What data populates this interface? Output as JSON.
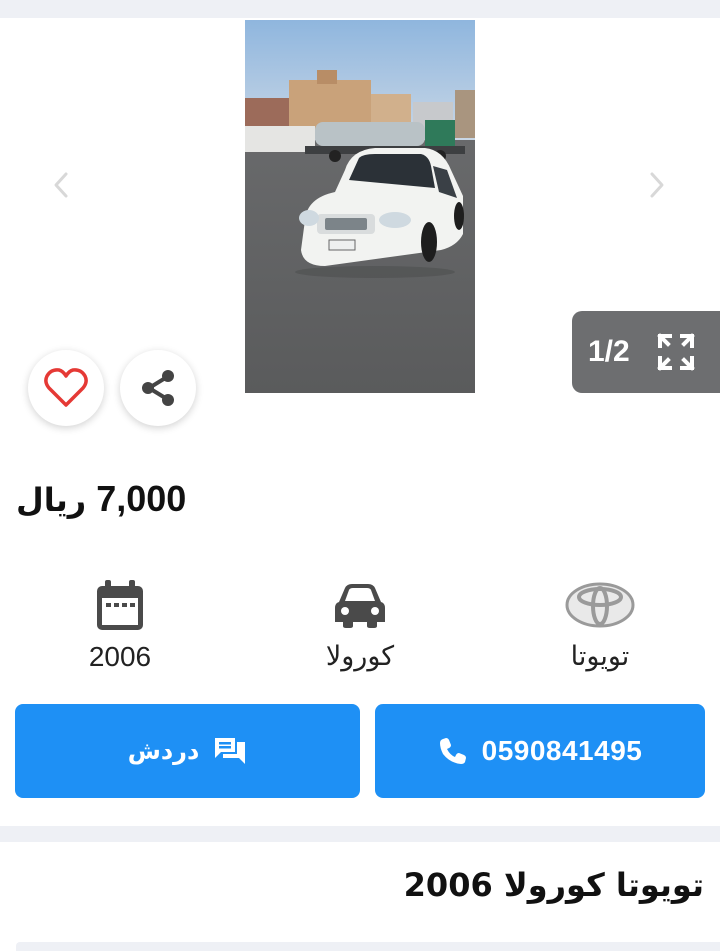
{
  "gallery": {
    "counter": "1/2",
    "prev_icon": "chevron-left-icon",
    "next_icon": "chevron-right-icon",
    "fullscreen_icon": "expand-icon",
    "favorite_icon": "heart-icon",
    "share_icon": "share-icon",
    "accent": "#e53935"
  },
  "listing": {
    "price_value": "7,000",
    "price_currency": "ريال",
    "title": "تويوتا كورولا 2006"
  },
  "specs": {
    "year": "2006",
    "model": "كورولا",
    "make": "تويوتا",
    "year_icon": "calendar-icon",
    "model_icon": "car-icon",
    "make_icon": "toyota-logo-icon"
  },
  "actions": {
    "chat_label": "دردش",
    "chat_icon": "chat-icon",
    "phone": "0590841495",
    "phone_icon": "phone-icon",
    "button_color": "#1e90f5"
  }
}
